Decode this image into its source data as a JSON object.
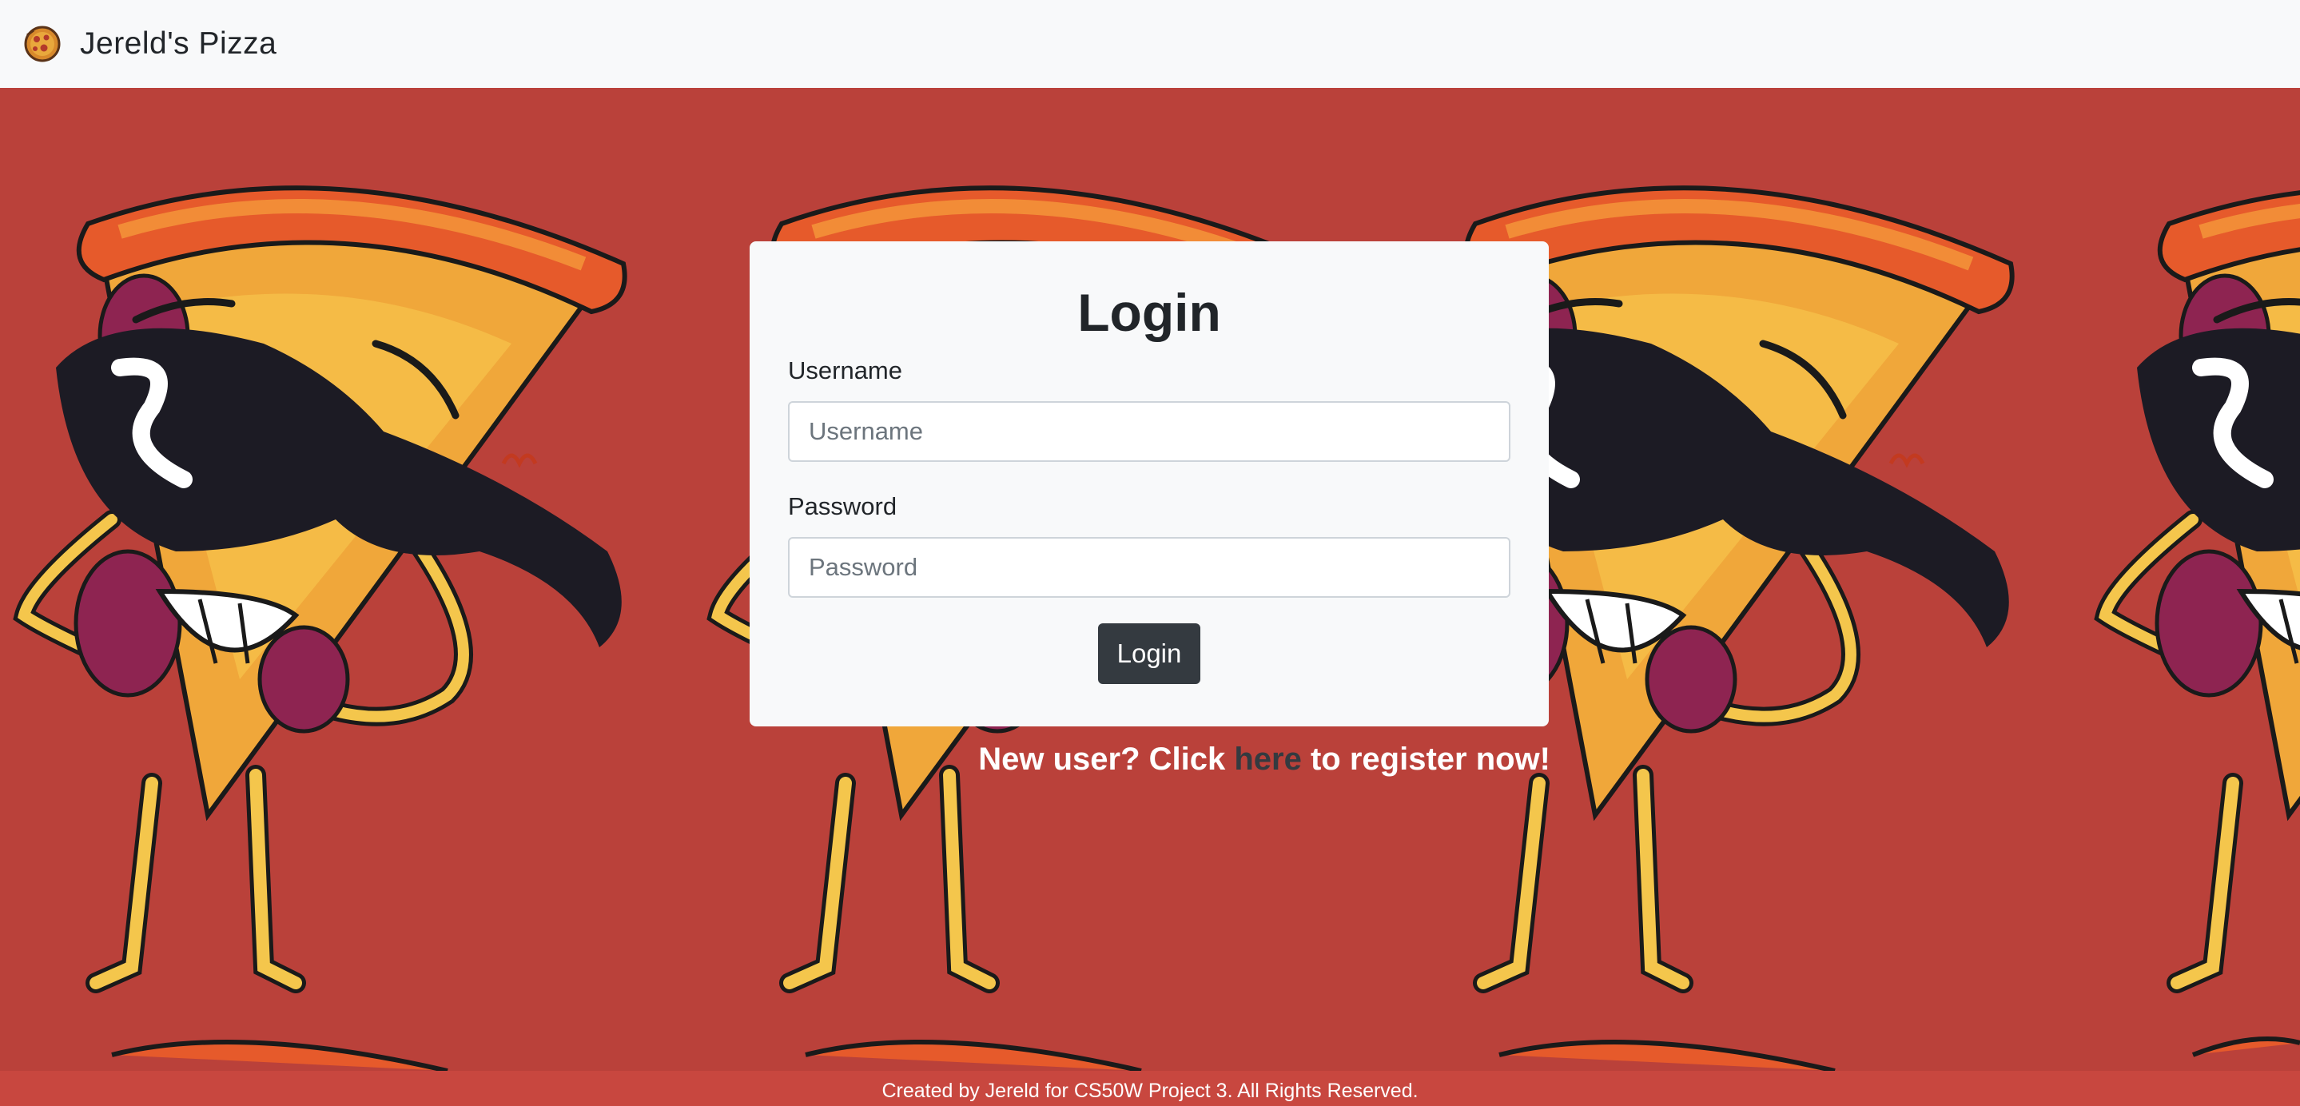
{
  "navbar": {
    "brand_text": "Jereld's Pizza",
    "brand_icon": "pizza-icon"
  },
  "background": {
    "pattern": "cartoon-pizza-slice-with-sunglasses",
    "color": "#ba413a"
  },
  "login": {
    "title": "Login",
    "username_label": "Username",
    "username_placeholder": "Username",
    "username_value": "",
    "password_label": "Password",
    "password_placeholder": "Password",
    "password_value": "",
    "button_label": "Login"
  },
  "register": {
    "prefix": "New user? Click ",
    "link_text": "here",
    "suffix": " to register now!"
  },
  "footer": {
    "text": "Created by Jereld for CS50W Project 3. All Rights Reserved."
  },
  "colors": {
    "navbar_bg": "#f8f9fa",
    "page_bg": "#ba413a",
    "button_bg": "#343a40",
    "text_dark": "#212529"
  }
}
